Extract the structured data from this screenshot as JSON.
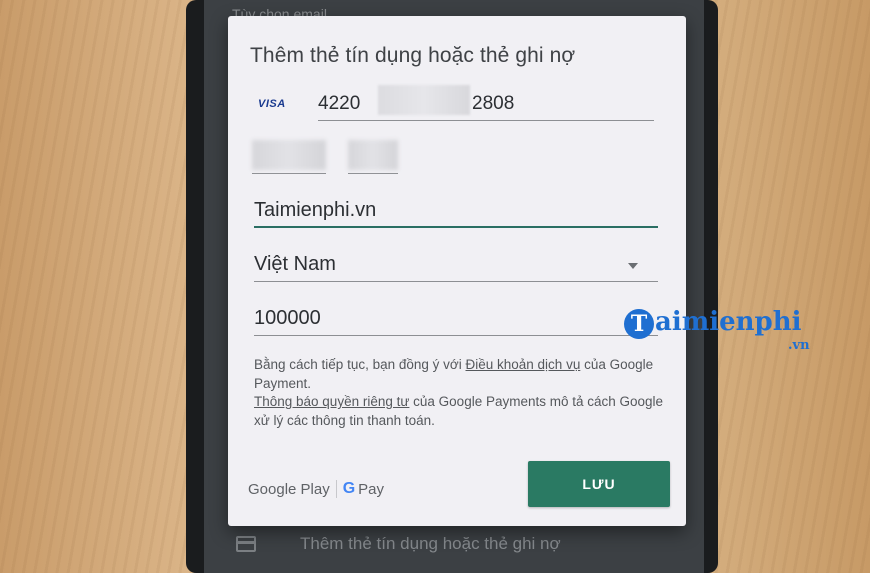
{
  "background": {
    "top_text": "Tùy chọn email",
    "bottom_text": "Thêm thẻ tín dụng hoặc thẻ ghi nợ"
  },
  "dialog": {
    "title": "Thêm thẻ tín dụng hoặc thẻ ghi nợ",
    "card_brand": "VISA",
    "card_number_start": "4220",
    "card_number_end": "2808",
    "name_value": "Taimienphi.vn",
    "country_value": "Việt Nam",
    "amount_value": "100000",
    "terms": {
      "line1_prefix": "Bằng cách tiếp tục, bạn đồng ý với ",
      "tos_link": "Điều khoản dịch vụ",
      "line1_suffix": " của Google Payment.",
      "privacy_link": "Thông báo quyền riêng tư",
      "line2_suffix": " của Google Payments mô tả cách Google xử lý các thông tin thanh toán."
    },
    "footer": {
      "google_play": "Google Play",
      "gpay_g": "G",
      "gpay_pay": "Pay"
    },
    "save_label": "LƯU"
  },
  "watermark": {
    "logo_letter": "T",
    "text": "aimienphi",
    "suffix": ".vn"
  },
  "colors": {
    "accent": "#2a7a63",
    "dialog_bg": "#f1f0f4",
    "watermark": "#1f6fd1"
  }
}
